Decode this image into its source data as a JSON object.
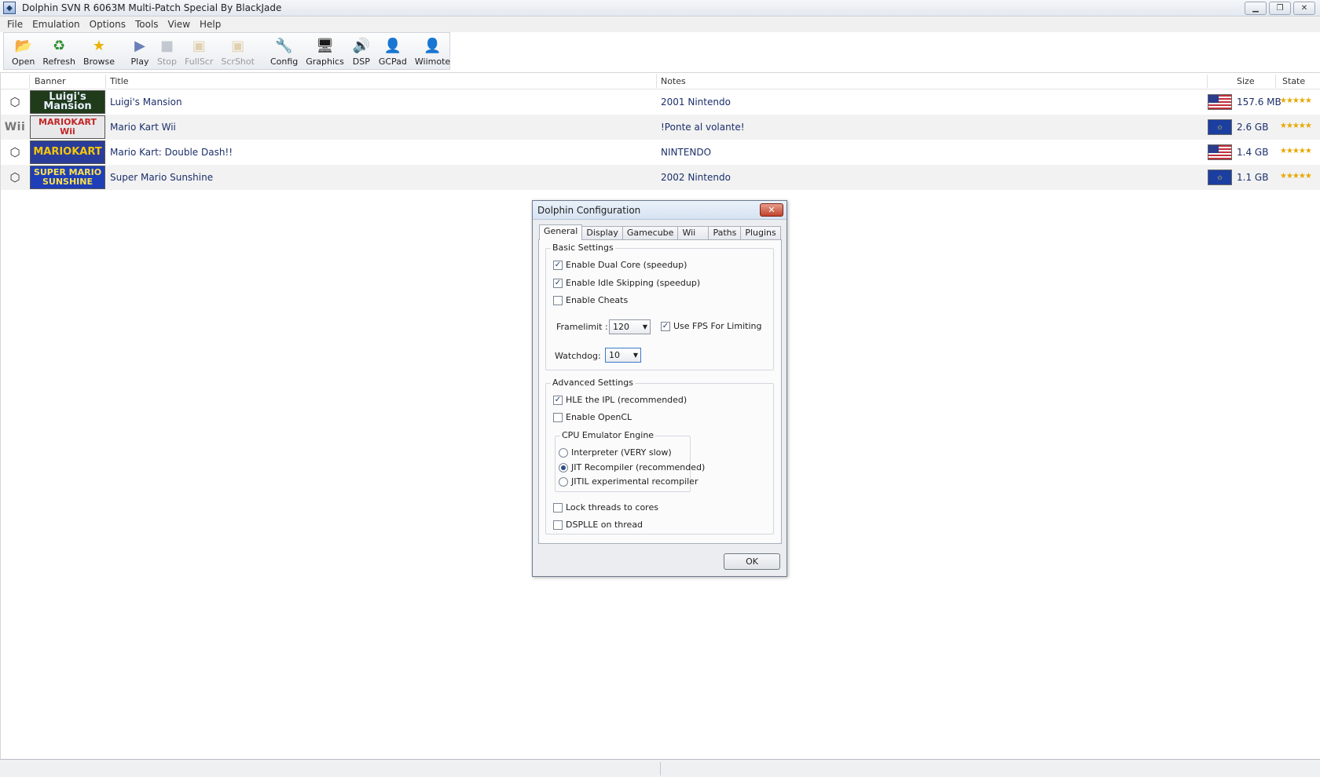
{
  "window": {
    "title": "Dolphin SVN R 6063M Multi-Patch Special By BlackJade",
    "minimize": "▁",
    "maximize": "❐",
    "close": "✕"
  },
  "menu": [
    "File",
    "Emulation",
    "Options",
    "Tools",
    "View",
    "Help"
  ],
  "toolbar": [
    {
      "label": "Open",
      "icon": "folder-icon",
      "glyph": "📂",
      "enabled": true
    },
    {
      "label": "Refresh",
      "icon": "refresh-icon",
      "glyph": "♻",
      "enabled": true
    },
    {
      "label": "Browse",
      "icon": "star-icon",
      "glyph": "★",
      "enabled": true
    },
    {
      "label": "Play",
      "icon": "play-icon",
      "glyph": "▶",
      "enabled": true
    },
    {
      "label": "Stop",
      "icon": "stop-icon",
      "glyph": "■",
      "enabled": false
    },
    {
      "label": "FullScr",
      "icon": "fullscreen-icon",
      "glyph": "▣",
      "enabled": false
    },
    {
      "label": "ScrShot",
      "icon": "screenshot-icon",
      "glyph": "▣",
      "enabled": false
    },
    {
      "label": "Config",
      "icon": "wrench-icon",
      "glyph": "🔧",
      "enabled": true
    },
    {
      "label": "Graphics",
      "icon": "monitor-icon",
      "glyph": "🖥",
      "enabled": true
    },
    {
      "label": "DSP",
      "icon": "speaker-icon",
      "glyph": "🔊",
      "enabled": true
    },
    {
      "label": "GCPad",
      "icon": "gamepad-icon",
      "glyph": "👤",
      "enabled": true
    },
    {
      "label": "Wiimote",
      "icon": "wiimote-icon",
      "glyph": "👤",
      "enabled": true
    }
  ],
  "list": {
    "columns": {
      "banner": "Banner",
      "title": "Title",
      "notes": "Notes",
      "size": "Size",
      "state": "State"
    },
    "rows": [
      {
        "platform": "gamecube",
        "platform_glyph": "⬡",
        "banner_text": "Luigi's Mansion",
        "banner_bg": "#1f3b1a",
        "banner_fg": "#e8f0ff",
        "title": "Luigi's Mansion",
        "notes": "2001 Nintendo",
        "region": "us",
        "size": "157.6 MB",
        "stars": "★★★★★"
      },
      {
        "platform": "wii",
        "platform_glyph": "Wii",
        "banner_text": "MARIOKART Wii",
        "banner_bg": "#e8e8ea",
        "banner_fg": "#c22626",
        "title": "Mario Kart Wii",
        "notes": "!Ponte al volante!",
        "region": "eu",
        "size": "2.6 GB",
        "stars": "★★★★★"
      },
      {
        "platform": "gamecube",
        "platform_glyph": "⬡",
        "banner_text": "MARIOKART",
        "banner_bg": "#2a3c9a",
        "banner_fg": "#f6c60a",
        "title": "Mario Kart: Double Dash!!",
        "notes": "NINTENDO",
        "region": "us",
        "size": "1.4 GB",
        "stars": "★★★★★"
      },
      {
        "platform": "gamecube",
        "platform_glyph": "⬡",
        "banner_text": "SUPER MARIO SUNSHINE",
        "banner_bg": "#1e3fb8",
        "banner_fg": "#ffe14d",
        "title": "Super Mario Sunshine",
        "notes": "2002  Nintendo",
        "region": "eu",
        "size": "1.1 GB",
        "stars": "★★★★★"
      }
    ]
  },
  "dialog": {
    "title": "Dolphin Configuration",
    "close": "✕",
    "tabs": [
      "General",
      "Display",
      "Gamecube",
      "Wii",
      "Paths",
      "Plugins"
    ],
    "basic": {
      "title": "Basic Settings",
      "dual_core": {
        "label": "Enable Dual Core (speedup)",
        "checked": true
      },
      "idle_skip": {
        "label": "Enable Idle Skipping (speedup)",
        "checked": true
      },
      "cheats": {
        "label": "Enable Cheats",
        "checked": false
      },
      "framelimit_label": "Framelimit :",
      "framelimit_value": "120",
      "use_fps": {
        "label": "Use FPS  For Limiting",
        "checked": true
      },
      "watchdog_label": "Watchdog:",
      "watchdog_value": "10"
    },
    "advanced": {
      "title": "Advanced Settings",
      "hle_ipl": {
        "label": "HLE the IPL (recommended)",
        "checked": true
      },
      "opencl": {
        "label": "Enable OpenCL",
        "checked": false
      },
      "cpu_title": "CPU Emulator Engine",
      "cpu_interpreter": {
        "label": "Interpreter (VERY slow)",
        "selected": false
      },
      "cpu_jit": {
        "label": "JIT Recompiler (recommended)",
        "selected": true
      },
      "cpu_jitil": {
        "label": "JITIL experimental recompiler",
        "selected": false
      },
      "lock_threads": {
        "label": "Lock threads to cores",
        "checked": false
      },
      "dsplle_thread": {
        "label": "DSPLLE on thread",
        "checked": false
      }
    },
    "ok": "OK",
    "check_glyph": "✓",
    "arrow_glyph": "▼"
  }
}
